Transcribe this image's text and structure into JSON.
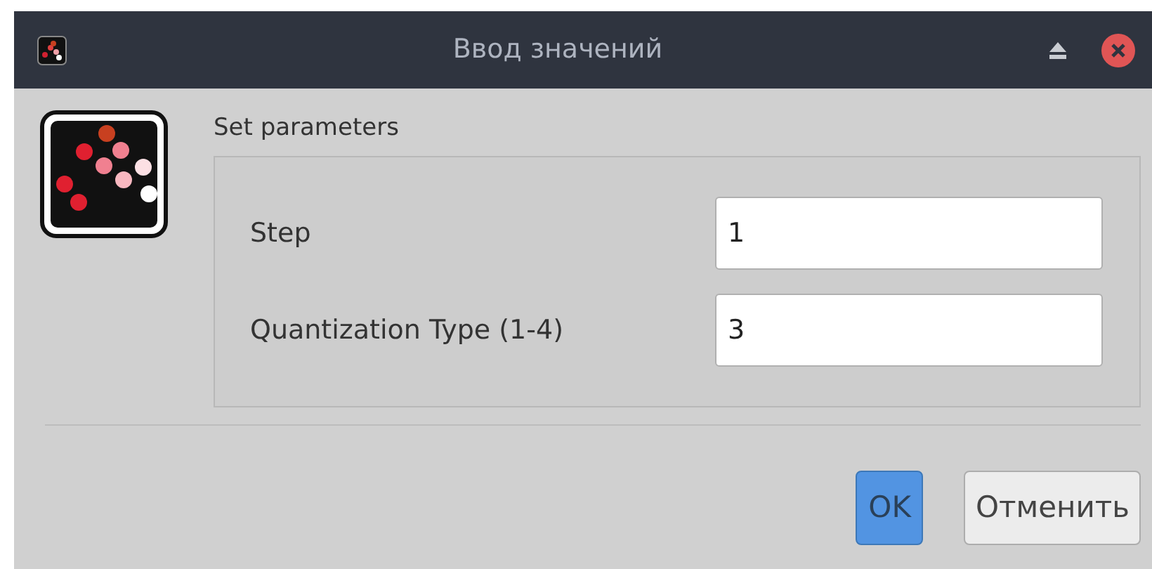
{
  "window": {
    "title": "Ввод значений"
  },
  "group": {
    "title": "Set parameters"
  },
  "fields": [
    {
      "label": "Step",
      "value": "1"
    },
    {
      "label": "Quantization Type (1-4)",
      "value": "3"
    }
  ],
  "buttons": [
    {
      "label": "OK",
      "default": true
    },
    {
      "label": "Отменить",
      "default": false
    }
  ]
}
